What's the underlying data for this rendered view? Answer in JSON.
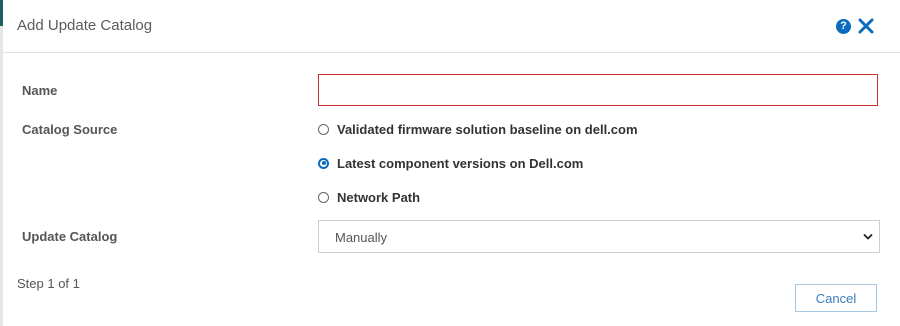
{
  "dialog": {
    "title": "Add Update Catalog",
    "help_icon": "question-circle-icon",
    "close_icon": "close-x-icon"
  },
  "form": {
    "name": {
      "label": "Name",
      "value": "",
      "state": "invalid"
    },
    "catalog_source": {
      "label": "Catalog Source",
      "options": [
        {
          "label": "Validated firmware solution baseline on dell.com",
          "selected": false
        },
        {
          "label": "Latest component versions on Dell.com",
          "selected": true
        },
        {
          "label": "Network Path",
          "selected": false
        }
      ]
    },
    "update_catalog": {
      "label": "Update Catalog",
      "selected": "Manually"
    }
  },
  "footer": {
    "step": "Step 1 of 1",
    "cancel_label": "Cancel"
  },
  "colors": {
    "accent": "#0a6bbf",
    "error_border": "#c9302c",
    "button_text": "#3a7dc0"
  }
}
